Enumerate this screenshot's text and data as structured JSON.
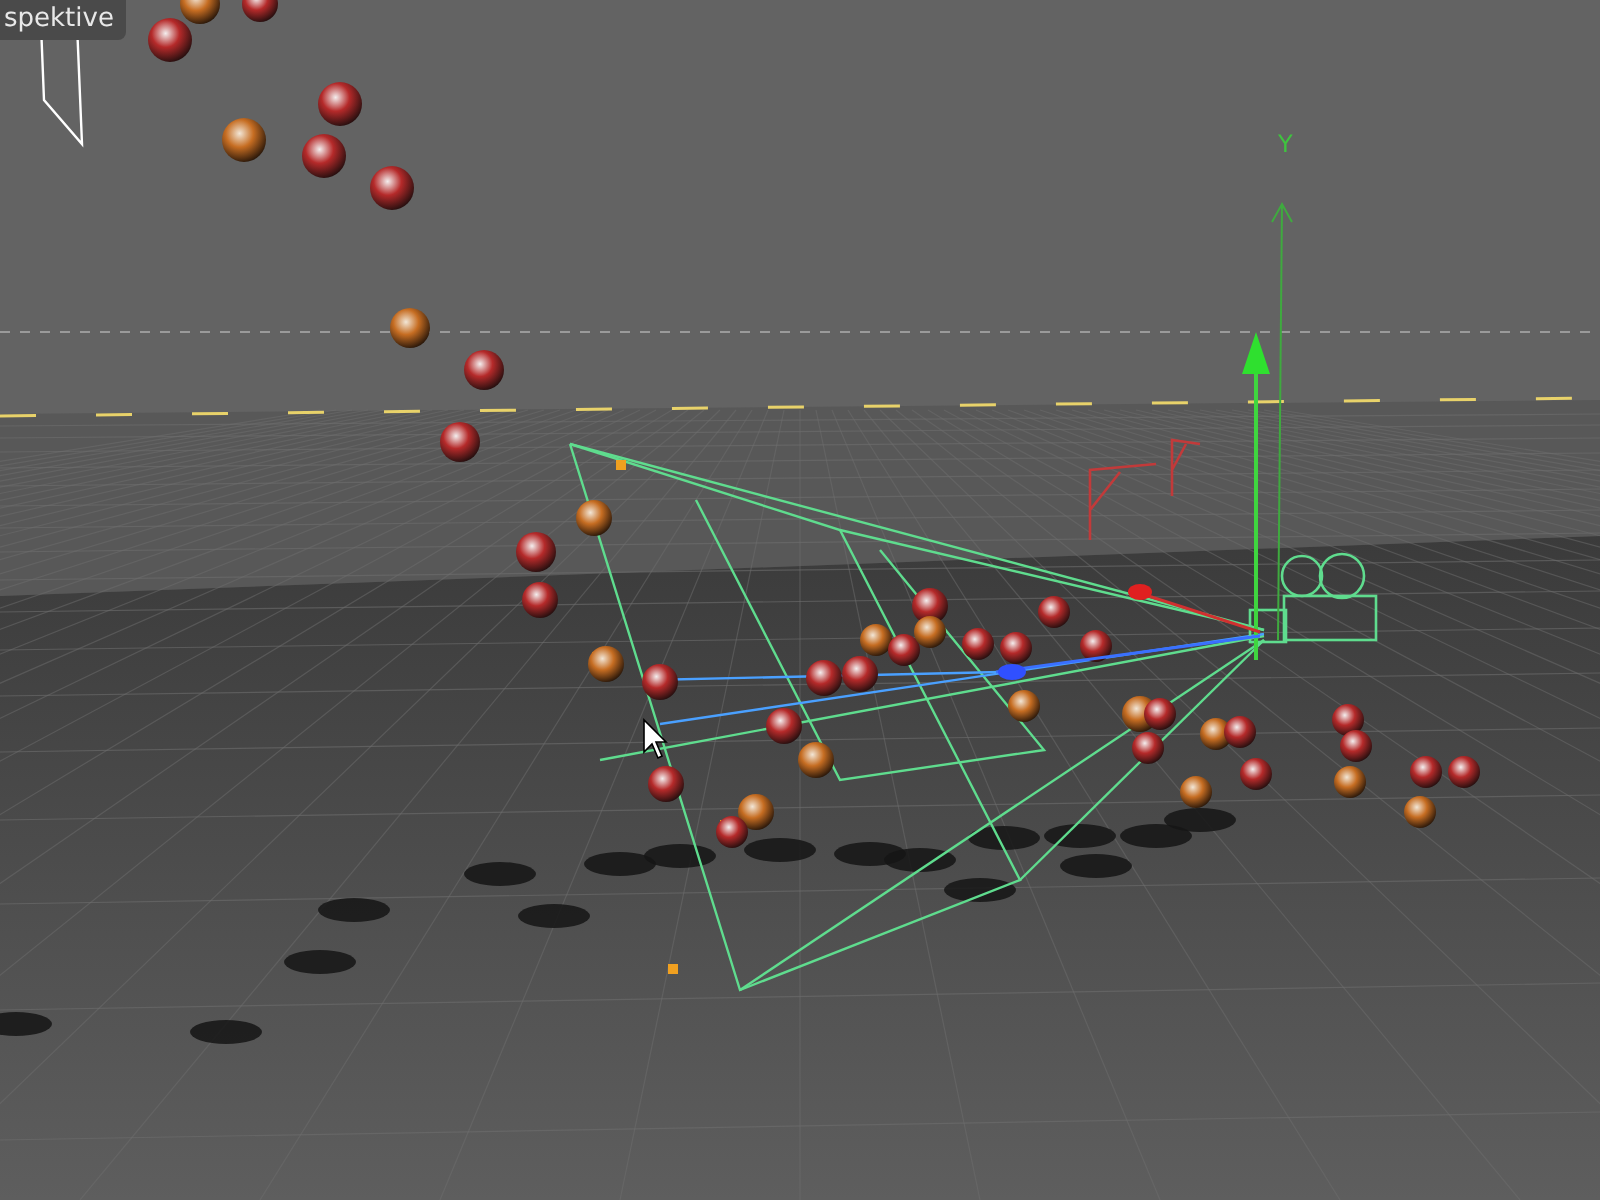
{
  "viewport": {
    "label": "spektive",
    "axis_label": "Y"
  }
}
